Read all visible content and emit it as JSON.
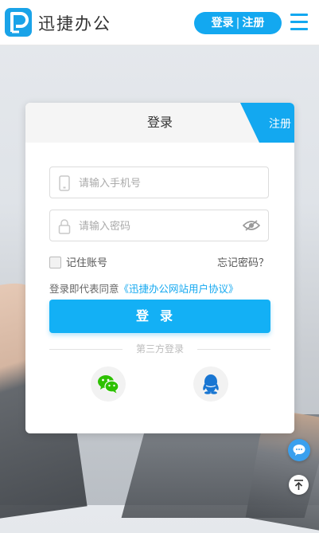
{
  "header": {
    "logo_text": "迅捷办公",
    "login_label": "登录",
    "separator": "|",
    "register_label": "注册",
    "brand_color": "#13a8f0"
  },
  "card": {
    "title": "登录",
    "register_tab": "注册",
    "phone_placeholder": "请输入手机号",
    "password_placeholder": "请输入密码",
    "remember_label": "记住账号",
    "forgot_label": "忘记密码？",
    "agree_prefix": "登录即代表同意",
    "agree_link": "《迅捷办公网站用户协议》",
    "login_button": "登录",
    "third_party_label": "第三方登录",
    "social": [
      "wechat-icon",
      "qq-icon"
    ]
  },
  "floating": {
    "chat": "chat-bubble-icon",
    "top": "back-to-top-icon"
  }
}
